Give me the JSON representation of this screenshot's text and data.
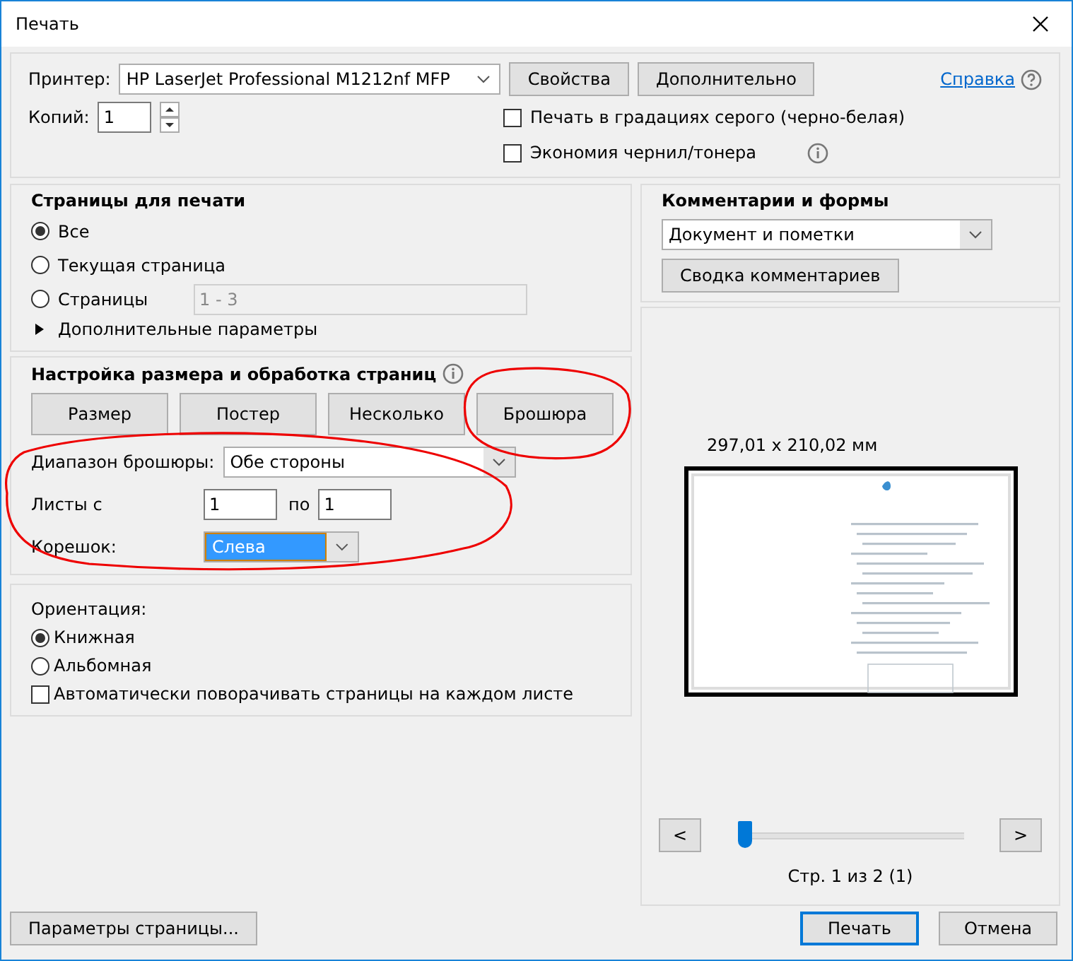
{
  "window": {
    "title": "Печать"
  },
  "printer": {
    "label": "Принтер:",
    "value": "HP LaserJet Professional M1212nf MFP",
    "buttons": [
      "Свойства",
      "Дополнительно"
    ]
  },
  "help": {
    "link": "Справка"
  },
  "copies": {
    "label": "Копий:",
    "value": "1"
  },
  "options": [
    {
      "label": "Печать в градациях серого (черно-белая)",
      "checked": false,
      "info": false
    },
    {
      "label": "Экономия чернил/тонера",
      "checked": false,
      "info": true
    }
  ],
  "pages": {
    "title": "Страницы для печати",
    "choices": [
      {
        "label": "Все",
        "selected": true
      },
      {
        "label": "Текущая страница",
        "selected": false
      },
      {
        "label": "Страницы",
        "selected": false,
        "value": "1 - 3",
        "disabled": true
      }
    ],
    "more": {
      "label": "Дополнительные параметры",
      "expanded": false
    }
  },
  "sizing": {
    "title": "Настройка размера и обработка страниц",
    "modes": [
      "Размер",
      "Постер",
      "Несколько",
      "Брошюра"
    ],
    "booklet": {
      "range_label": "Диапазон брошюры:",
      "range_value": "Обе стороны",
      "sheets_label": "Листы с",
      "sheets_from": "1",
      "to_label": "по",
      "sheets_to": "1",
      "binding_label": "Корешок:",
      "binding_value": "Слева",
      "binding_focused": true
    }
  },
  "orientation": {
    "title": "Ориентация:",
    "choices": [
      {
        "label": "Книжная",
        "selected": true
      },
      {
        "label": "Альбомная",
        "selected": false
      }
    ],
    "auto_rotate": {
      "label": "Автоматически поворачивать страницы на каждом листе",
      "checked": false
    }
  },
  "comments": {
    "title": "Комментарии и формы",
    "value": "Документ и пометки",
    "button": "Сводка комментариев"
  },
  "preview": {
    "size": "297,01 x 210,02 мм",
    "prev": "<",
    "next": ">",
    "level": 0,
    "page_label": "Стр. 1 из 2 (1)"
  },
  "footer": {
    "page_setup": "Параметры страницы...",
    "print": "Печать",
    "cancel": "Отмена"
  }
}
